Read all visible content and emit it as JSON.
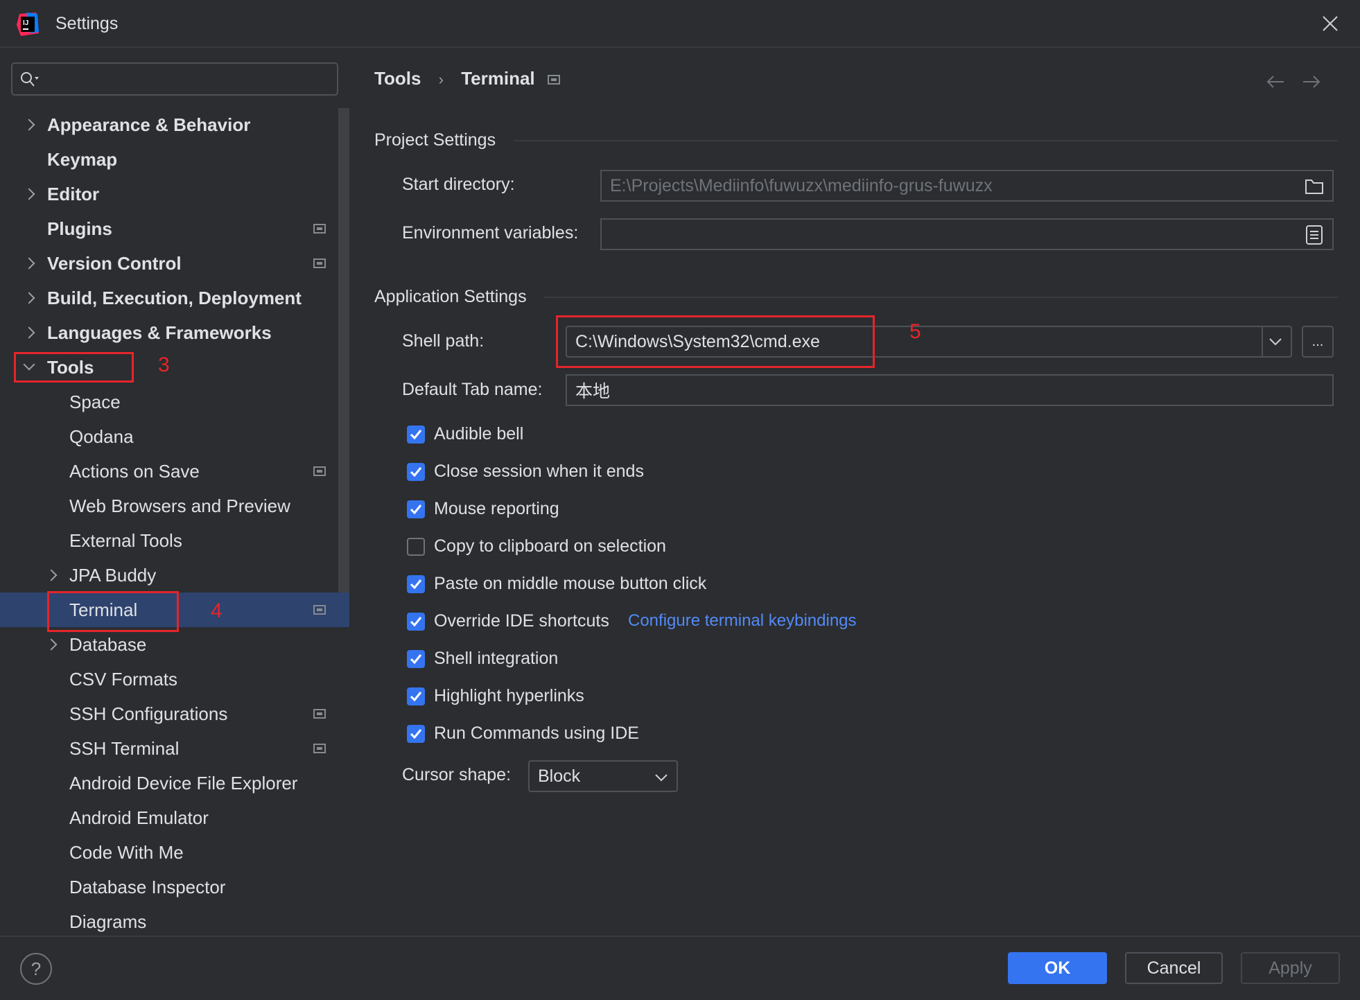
{
  "window": {
    "title": "Settings",
    "icon": "intellij-logo-icon"
  },
  "search": {
    "placeholder": "",
    "icon": "search-icon"
  },
  "sidebar": {
    "items": [
      {
        "label": "Appearance & Behavior",
        "level": 0,
        "expandable": true,
        "bold": true
      },
      {
        "label": "Keymap",
        "level": 0,
        "bold": true
      },
      {
        "label": "Editor",
        "level": 0,
        "expandable": true,
        "bold": true
      },
      {
        "label": "Plugins",
        "level": 0,
        "bold": true,
        "project_icon": true
      },
      {
        "label": "Version Control",
        "level": 0,
        "expandable": true,
        "bold": true,
        "project_icon": true
      },
      {
        "label": "Build, Execution, Deployment",
        "level": 0,
        "expandable": true,
        "bold": true
      },
      {
        "label": "Languages & Frameworks",
        "level": 0,
        "expandable": true,
        "bold": true
      },
      {
        "label": "Tools",
        "level": 0,
        "expanded": true,
        "bold": true
      },
      {
        "label": "Space",
        "level": 1
      },
      {
        "label": "Qodana",
        "level": 1
      },
      {
        "label": "Actions on Save",
        "level": 1,
        "project_icon": true
      },
      {
        "label": "Web Browsers and Preview",
        "level": 1
      },
      {
        "label": "External Tools",
        "level": 1
      },
      {
        "label": "JPA Buddy",
        "level": 1,
        "expandable": true
      },
      {
        "label": "Terminal",
        "level": 1,
        "selected": true,
        "project_icon": true
      },
      {
        "label": "Database",
        "level": 1,
        "expandable": true
      },
      {
        "label": "CSV Formats",
        "level": 1
      },
      {
        "label": "SSH Configurations",
        "level": 1,
        "project_icon": true
      },
      {
        "label": "SSH Terminal",
        "level": 1,
        "project_icon": true
      },
      {
        "label": "Android Device File Explorer",
        "level": 1
      },
      {
        "label": "Android Emulator",
        "level": 1
      },
      {
        "label": "Code With Me",
        "level": 1
      },
      {
        "label": "Database Inspector",
        "level": 1
      },
      {
        "label": "Diagrams",
        "level": 1
      }
    ]
  },
  "annotations": {
    "n3": "3",
    "n4": "4",
    "n5": "5",
    "color": "#e5252a"
  },
  "breadcrumb": {
    "parent": "Tools",
    "sep": "›",
    "current": "Terminal"
  },
  "project_settings": {
    "title": "Project Settings",
    "start_dir_label": "Start directory:",
    "start_dir_value": "E:\\Projects\\Mediinfo\\fuwuzx\\mediinfo-grus-fuwuzx",
    "env_label": "Environment variables:",
    "env_value": ""
  },
  "app_settings": {
    "title": "Application Settings",
    "shell_label": "Shell path:",
    "shell_value": "C:\\Windows\\System32\\cmd.exe",
    "browse": "...",
    "tab_label": "Default Tab name:",
    "tab_value": "本地",
    "checkboxes": [
      {
        "label": "Audible bell",
        "checked": true
      },
      {
        "label": "Close session when it ends",
        "checked": true
      },
      {
        "label": "Mouse reporting",
        "checked": true
      },
      {
        "label": "Copy to clipboard on selection",
        "checked": false
      },
      {
        "label": "Paste on middle mouse button click",
        "checked": true
      },
      {
        "label": "Override IDE shortcuts",
        "checked": true
      },
      {
        "label": "Shell integration",
        "checked": true
      },
      {
        "label": "Highlight hyperlinks",
        "checked": true
      },
      {
        "label": "Run Commands using IDE",
        "checked": true
      }
    ],
    "keybindings_link": "Configure terminal keybindings",
    "cursor_label": "Cursor shape:",
    "cursor_value": "Block"
  },
  "footer": {
    "ok": "OK",
    "cancel": "Cancel",
    "apply": "Apply",
    "help": "?"
  },
  "colors": {
    "accent": "#3574f0",
    "link": "#548af7",
    "selection": "#2e436e",
    "bg": "#2b2d30"
  }
}
